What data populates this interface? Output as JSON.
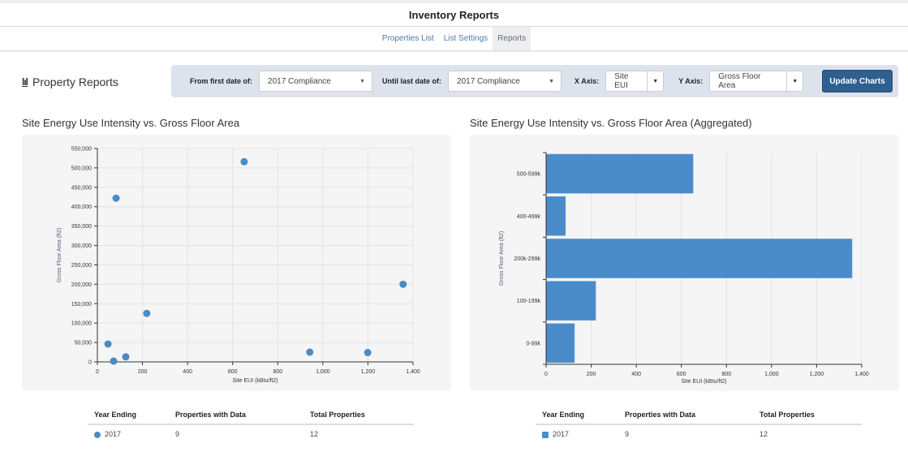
{
  "header": {
    "title": "Inventory Reports"
  },
  "subnav": {
    "items": [
      {
        "label": "Properties List"
      },
      {
        "label": "List Settings"
      },
      {
        "label": "Reports",
        "active": true
      }
    ]
  },
  "page": {
    "title": "Property Reports",
    "icon": "bar-chart-icon"
  },
  "filters": {
    "from_label": "From first date of:",
    "from_value": "2017 Compliance",
    "until_label": "Until last date of:",
    "until_value": "2017 Compliance",
    "xaxis_label": "X Axis:",
    "xaxis_value": "Site EUI",
    "yaxis_label": "Y Axis:",
    "yaxis_value": "Gross Floor Area",
    "update_label": "Update Charts"
  },
  "colors": {
    "accent": "#4a8bc9",
    "button": "#2f5f8f",
    "filter_bg": "#dce3ec",
    "axis_title": "#6b4a7a"
  },
  "chart_data": [
    {
      "type": "scatter",
      "title": "Site Energy Use Intensity vs. Gross Floor Area",
      "xlabel": "Site EUI (kBtu/ft2)",
      "ylabel": "Gross Floor Area (ft2)",
      "xlim": [
        0,
        1400
      ],
      "ylim": [
        0,
        550000
      ],
      "xticks": [
        0,
        200,
        400,
        600,
        800,
        1000,
        1200,
        1400
      ],
      "xtick_labels": [
        "0",
        "200",
        "400",
        "600",
        "800",
        "1,000",
        "1,200",
        "1,400"
      ],
      "yticks": [
        0,
        50000,
        100000,
        150000,
        200000,
        250000,
        300000,
        350000,
        400000,
        450000,
        500000,
        550000
      ],
      "ytick_labels": [
        "0",
        "50,000",
        "100,000",
        "150,000",
        "200,000",
        "250,000",
        "300,000",
        "350,000",
        "400,000",
        "450,000",
        "500,000",
        "550,000"
      ],
      "grid": true,
      "series": [
        {
          "name": "2017",
          "points": [
            [
              83,
              422000
            ],
            [
              651,
              516000
            ],
            [
              47,
              46000
            ],
            [
              72,
              2000
            ],
            [
              126,
              13000
            ],
            [
              219,
              125000
            ],
            [
              942,
              25000
            ],
            [
              1199,
              24000
            ],
            [
              1356,
              200000
            ]
          ]
        }
      ]
    },
    {
      "type": "bar",
      "orientation": "horizontal",
      "title": "Site Energy Use Intensity vs. Gross Floor Area (Aggregated)",
      "xlabel": "Site EUI (kBtu/ft2)",
      "ylabel": "Gross Floor Area (ft2)",
      "xlim": [
        0,
        1400
      ],
      "xticks": [
        0,
        200,
        400,
        600,
        800,
        1000,
        1200,
        1400
      ],
      "xtick_labels": [
        "0",
        "200",
        "400",
        "600",
        "800",
        "1,000",
        "1,200",
        "1,400"
      ],
      "grid": true,
      "categories": [
        "500-599k",
        "400-499k",
        "200k-299k",
        "100-199k",
        "0-99k"
      ],
      "series": [
        {
          "name": "2017",
          "values": [
            652,
            86,
            1357,
            220,
            126
          ]
        }
      ]
    }
  ],
  "legend_tables": [
    {
      "headers": [
        "Year Ending",
        "Properties with Data",
        "Total Properties"
      ],
      "rows": [
        [
          "2017",
          "9",
          "12"
        ]
      ]
    },
    {
      "headers": [
        "Year Ending",
        "Properties with Data",
        "Total Properties"
      ],
      "rows": [
        [
          "2017",
          "9",
          "12"
        ]
      ]
    }
  ]
}
